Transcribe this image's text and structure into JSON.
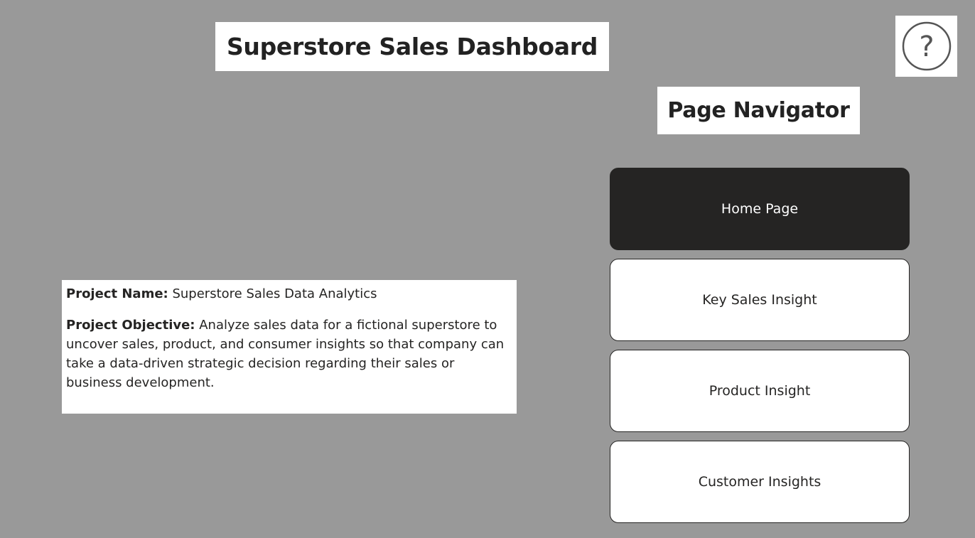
{
  "header": {
    "title": "Superstore Sales Dashboard",
    "help_icon": "question-mark-circle-icon"
  },
  "navigator": {
    "title": "Page Navigator",
    "buttons": [
      {
        "label": "Home Page",
        "active": true
      },
      {
        "label": "Key Sales Insight",
        "active": false
      },
      {
        "label": "Product Insight",
        "active": false
      },
      {
        "label": "Customer Insights",
        "active": false
      }
    ]
  },
  "project": {
    "name_label": "Project Name:",
    "name_value": " Superstore Sales Data Analytics",
    "objective_label": "Project Objective:",
    "objective_value": " Analyze sales data for a fictional superstore to uncover sales, product, and consumer insights so that company can take a data-driven strategic decision regarding their sales or business development."
  },
  "colors": {
    "background": "#999999",
    "panel": "#ffffff",
    "active_button": "#252423",
    "text": "#252423"
  }
}
